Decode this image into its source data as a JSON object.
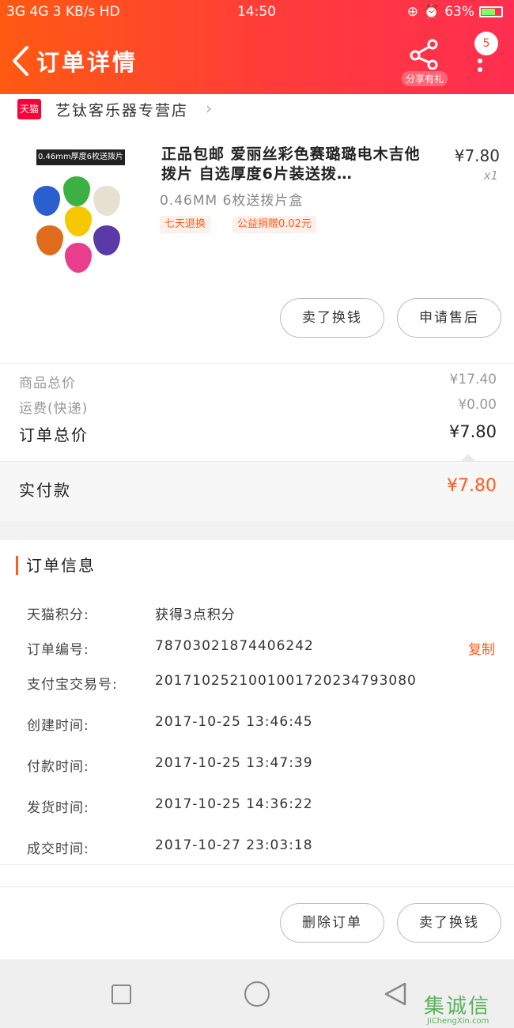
{
  "statusbar": {
    "left": "3G 4G 3 KB/s HD",
    "time": "14:50",
    "battery": "63%"
  },
  "header": {
    "title": "订单详情",
    "share_label": "分享有礼",
    "badge": "5"
  },
  "store": {
    "logo": "天猫",
    "name": "艺钛客乐器专营店"
  },
  "product": {
    "image_label": "0.46mm厚度6枚送拨片盒",
    "title": "正品包邮 爱丽丝彩色赛璐璐电木吉他拨片 自选厚度6片装送拨…",
    "price": "¥7.80",
    "qty": "x1",
    "sku": "0.46MM 6枚送拨片盒",
    "tags": [
      "七天退换",
      "公益捐赠0.02元"
    ],
    "buttons": [
      "卖了换钱",
      "申请售后"
    ]
  },
  "summary": {
    "goods_label": "商品总价",
    "goods_value": "¥17.40",
    "shipping_label": "运费(快递)",
    "shipping_value": "¥0.00",
    "total_label": "订单总价",
    "total_value": "¥7.80"
  },
  "paid": {
    "label": "实付款",
    "value": "¥7.80"
  },
  "order_info": {
    "title": "订单信息",
    "copy_label": "复制",
    "rows": [
      {
        "key": "天猫积分:",
        "value": "获得3点积分"
      },
      {
        "key": "订单编号:",
        "value": "78703021874406242"
      },
      {
        "key": "支付宝交易号:",
        "value": "2017102521001001720234793080"
      },
      {
        "key": "创建时间:",
        "value": "2017-10-25 13:46:45"
      },
      {
        "key": "付款时间:",
        "value": "2017-10-25 13:47:39"
      },
      {
        "key": "发货时间:",
        "value": "2017-10-25 14:36:22"
      },
      {
        "key": "成交时间:",
        "value": "2017-10-27 23:03:18"
      }
    ]
  },
  "actions": {
    "delete": "删除订单",
    "sell": "卖了换钱"
  },
  "watermark": {
    "big": "集诚信",
    "small": "JiChengXin.com"
  },
  "colors": {
    "accent": "#ff5a1f",
    "header_start": "#ff5a12",
    "header_end": "#ff2e50"
  }
}
